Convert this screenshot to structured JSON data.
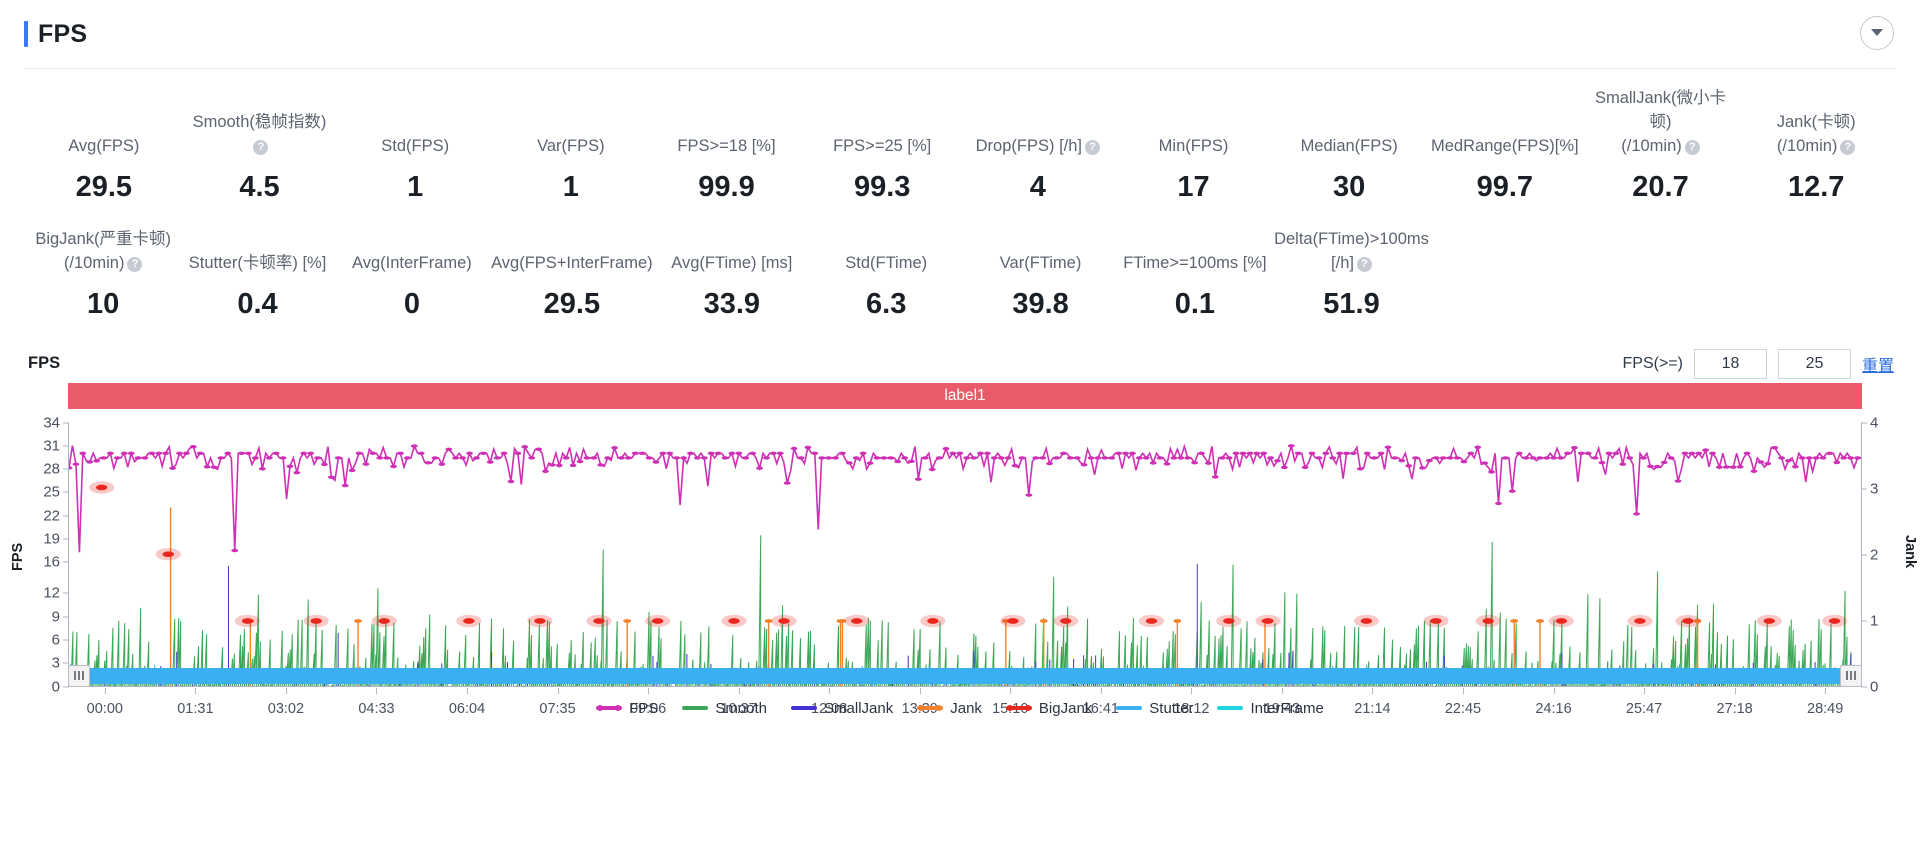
{
  "header": {
    "title": "FPS",
    "collapse_icon": "chevron-down-icon",
    "accent_color": "#3a7afe"
  },
  "metrics": {
    "row1": [
      {
        "label": "Avg(FPS)",
        "help": false,
        "value": "29.5"
      },
      {
        "label": "Smooth(稳帧指数)",
        "help": true,
        "value": "4.5"
      },
      {
        "label": "Std(FPS)",
        "help": false,
        "value": "1"
      },
      {
        "label": "Var(FPS)",
        "help": false,
        "value": "1"
      },
      {
        "label": "FPS>=18 [%]",
        "help": false,
        "value": "99.9"
      },
      {
        "label": "FPS>=25 [%]",
        "help": false,
        "value": "99.3"
      },
      {
        "label": "Drop(FPS) [/h]",
        "help": true,
        "value": "4"
      },
      {
        "label": "Min(FPS)",
        "help": false,
        "value": "17"
      },
      {
        "label": "Median(FPS)",
        "help": false,
        "value": "30"
      },
      {
        "label": "MedRange(FPS)[%]",
        "help": false,
        "value": "99.7"
      },
      {
        "label": "SmallJank(微小卡顿)\n(/10min)",
        "help": true,
        "value": "20.7"
      },
      {
        "label": "Jank(卡顿)\n(/10min)",
        "help": true,
        "value": "12.7"
      }
    ],
    "row2": [
      {
        "label": "BigJank(严重卡顿)\n(/10min)",
        "help": true,
        "value": "10"
      },
      {
        "label": "Stutter(卡顿率) [%]",
        "help": false,
        "value": "0.4"
      },
      {
        "label": "Avg(InterFrame)",
        "help": false,
        "value": "0"
      },
      {
        "label": "Avg(FPS+InterFrame)",
        "help": false,
        "value": "29.5"
      },
      {
        "label": "Avg(FTime) [ms]",
        "help": false,
        "value": "33.9"
      },
      {
        "label": "Std(FTime)",
        "help": false,
        "value": "6.3"
      },
      {
        "label": "Var(FTime)",
        "help": false,
        "value": "39.8"
      },
      {
        "label": "FTime>=100ms [%]",
        "help": false,
        "value": "0.1"
      },
      {
        "label": "Delta(FTime)>100ms [/h]",
        "help": true,
        "value": "51.9"
      }
    ]
  },
  "chart_panel": {
    "name": "FPS",
    "threshold_label": "FPS(>=)",
    "threshold_1": "18",
    "threshold_2": "25",
    "reset_label": "重置",
    "band_label": "label1",
    "band_color": "#ea5b6a"
  },
  "chart_data": {
    "type": "line",
    "title": "FPS",
    "xlabel": "",
    "ylabel": "FPS",
    "y2label": "Jank",
    "ylim": [
      0,
      34
    ],
    "y2lim": [
      0,
      4
    ],
    "grid": false,
    "legend_position": "bottom",
    "yticks": [
      0,
      3,
      6,
      9,
      12,
      16,
      19,
      22,
      25,
      28,
      31,
      34
    ],
    "y2ticks": [
      0,
      1,
      2,
      3,
      4
    ],
    "xticks": [
      "00:00",
      "01:31",
      "03:02",
      "04:33",
      "06:04",
      "07:35",
      "09:06",
      "10:37",
      "12:08",
      "13:39",
      "15:10",
      "16:41",
      "18:12",
      "19:43",
      "21:14",
      "22:45",
      "24:16",
      "25:47",
      "27:18",
      "28:49"
    ],
    "series": [
      {
        "name": "FPS",
        "color": "#cf2fb4",
        "axis": "left",
        "baseline": 29.5,
        "marker": true
      },
      {
        "name": "Smooth",
        "color": "#3ca757",
        "axis": "left",
        "baseline": 4.5,
        "marker": false
      },
      {
        "name": "SmallJank",
        "color": "#4432d6",
        "axis": "right",
        "baseline": 0,
        "marker": false
      },
      {
        "name": "Jank",
        "color": "#f2812a",
        "axis": "right",
        "baseline": 0,
        "marker": true
      },
      {
        "name": "BigJank",
        "color": "#e8281e",
        "axis": "right",
        "baseline": 0,
        "marker": true
      },
      {
        "name": "Stutter",
        "color": "#3ab0f3",
        "axis": "right",
        "baseline": 0,
        "marker": false
      },
      {
        "name": "InterFrame",
        "color": "#1fd5e0",
        "axis": "right",
        "baseline": 0,
        "marker": false
      }
    ]
  },
  "legend": [
    {
      "label": "FPS",
      "color": "#cf2fb4",
      "marker": true
    },
    {
      "label": "Smooth",
      "color": "#3ca757",
      "marker": false
    },
    {
      "label": "SmallJank",
      "color": "#4432d6",
      "marker": false
    },
    {
      "label": "Jank",
      "color": "#f2812a",
      "marker": true
    },
    {
      "label": "BigJank",
      "color": "#e8281e",
      "marker": true
    },
    {
      "label": "Stutter",
      "color": "#3ab0f3",
      "marker": false
    },
    {
      "label": "InterFrame",
      "color": "#1fd5e0",
      "marker": false
    }
  ]
}
